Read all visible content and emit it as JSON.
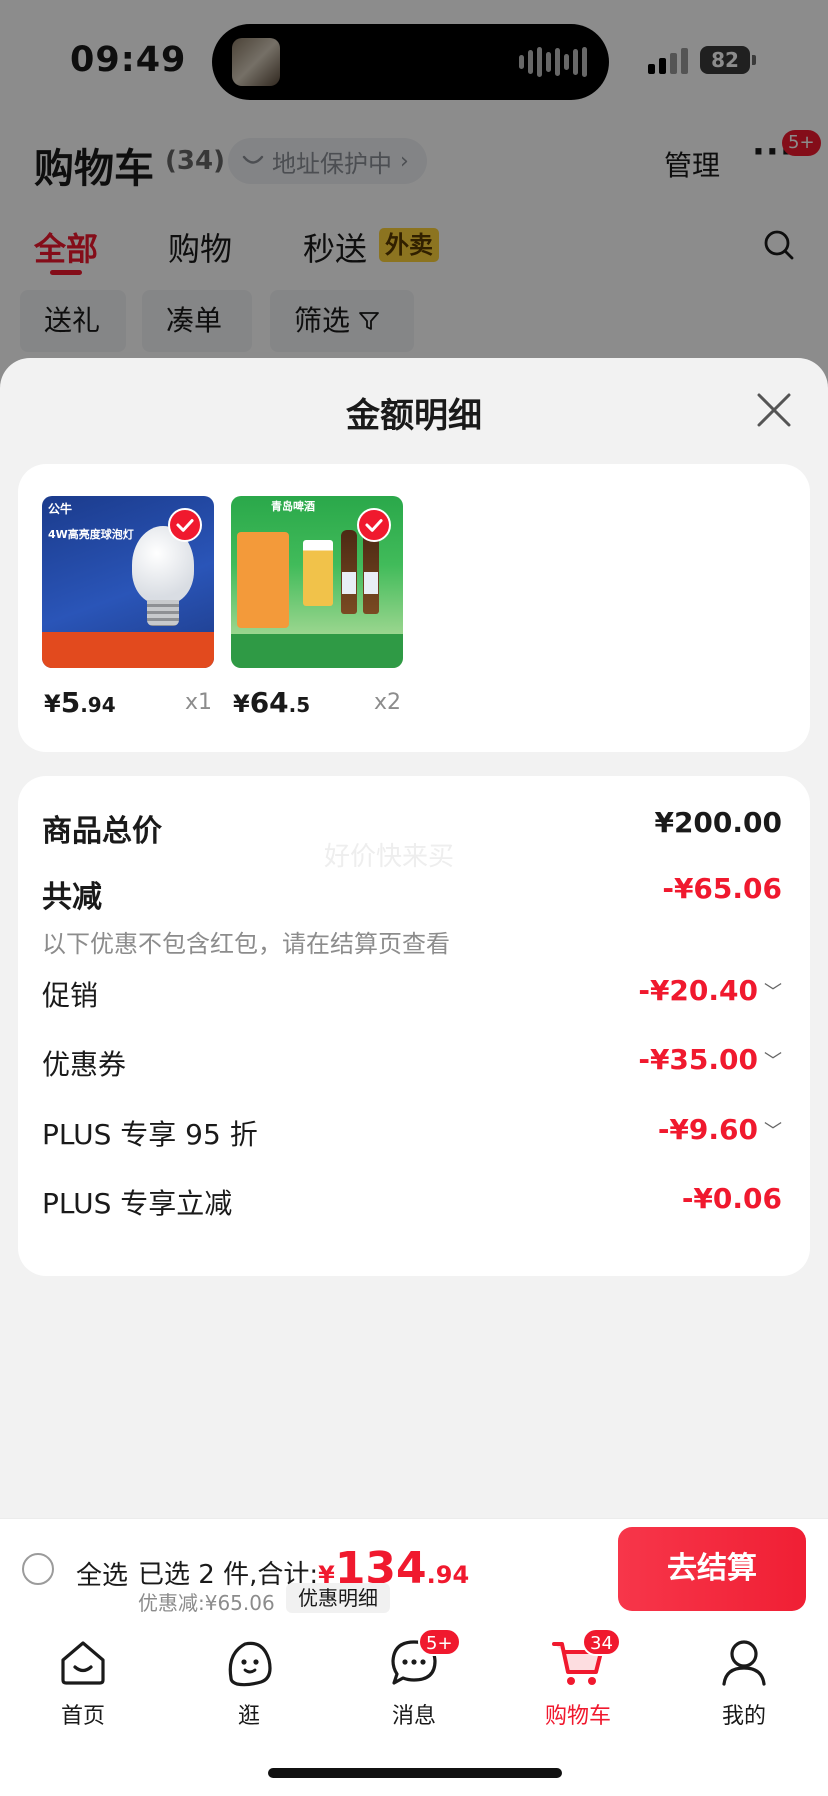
{
  "status_bar": {
    "time": "09:49",
    "battery": "82"
  },
  "header": {
    "title": "购物车",
    "count": "(34)",
    "address_status": "地址保护中",
    "manage_label": "管理",
    "more_badge": "5+"
  },
  "tabs": [
    {
      "label": "全部",
      "active": true
    },
    {
      "label": "购物"
    },
    {
      "label": "秒送",
      "badge": "外卖"
    }
  ],
  "chips": [
    "送礼",
    "凑单",
    "筛选"
  ],
  "modal": {
    "title": "金额明细",
    "products": [
      {
        "name": "4W高亮度球泡灯",
        "brand": "公牛",
        "price_symbol": "¥",
        "price_int": "5",
        "price_dec": ".94",
        "quantity": "x1",
        "selected": true
      },
      {
        "name": "青岛啤酒",
        "brand": "青岛啤酒",
        "price_symbol": "¥",
        "price_int": "64",
        "price_dec": ".5",
        "quantity": "x2",
        "selected": true
      }
    ],
    "watermark": "好价快来买",
    "breakdown": {
      "subtotal_label": "商品总价",
      "subtotal_value": "¥200.00",
      "total_discount_label": "共减",
      "total_discount_value": "-¥65.06",
      "note": "以下优惠不包含红包，请在结算页查看",
      "items": [
        {
          "label": "促销",
          "value": "-¥20.40",
          "expandable": true
        },
        {
          "label": "优惠券",
          "value": "-¥35.00",
          "expandable": true
        },
        {
          "label": "PLUS 专享 95 折",
          "value": "-¥9.60",
          "expandable": true
        },
        {
          "label": "PLUS 专享立减",
          "value": "-¥0.06",
          "expandable": false
        }
      ]
    }
  },
  "checkout": {
    "select_all_label": "全选",
    "selected_text": "已选 2 件,合计:",
    "total_symbol": "¥",
    "total_int": "134",
    "total_dec": ".94",
    "discount_text": "优惠减:¥65.06",
    "detail_label": "优惠明细",
    "button_label": "去结算"
  },
  "bottom_nav": [
    {
      "label": "首页",
      "icon": "home-icon"
    },
    {
      "label": "逛",
      "icon": "browse-icon"
    },
    {
      "label": "消息",
      "icon": "message-icon",
      "badge": "5+"
    },
    {
      "label": "购物车",
      "icon": "cart-icon",
      "badge": "34",
      "active": true
    },
    {
      "label": "我的",
      "icon": "profile-icon"
    }
  ],
  "colors": {
    "accent": "#f0192e",
    "tab_badge": "#ffd43b",
    "text": "#1a1a1a",
    "muted": "#8c8c8c"
  }
}
